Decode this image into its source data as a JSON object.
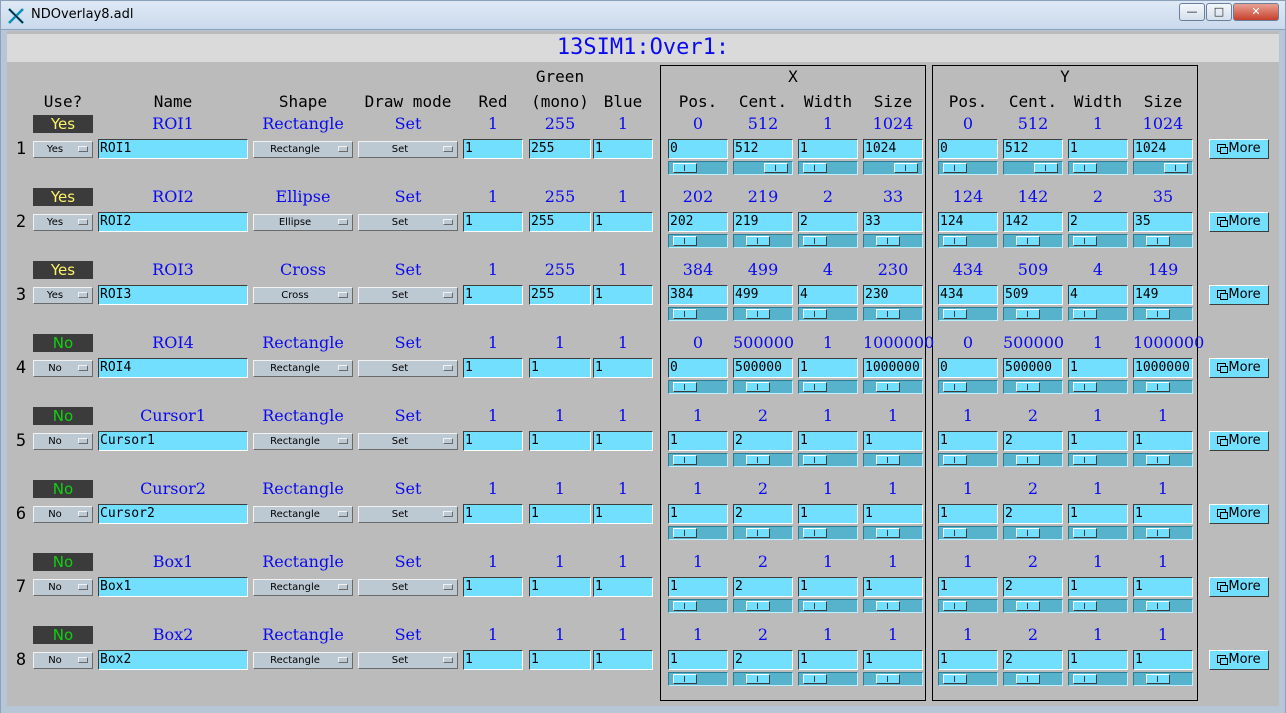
{
  "window": {
    "title": "NDOverlay8.adl",
    "min": "—",
    "max": "□",
    "close": "✕"
  },
  "screen_title": "13SIM1:Over1:",
  "headers": {
    "use": "Use?",
    "name": "Name",
    "shape": "Shape",
    "draw_mode": "Draw mode",
    "red": "Red",
    "green_top": "Green",
    "green_bottom": "(mono)",
    "blue": "Blue",
    "x_group": "X",
    "y_group": "Y",
    "pos": "Pos.",
    "cent": "Cent.",
    "width": "Width",
    "size": "Size"
  },
  "more_label": "More",
  "rows": [
    {
      "num": "1",
      "use": "Yes",
      "use_sel": "Yes",
      "name": "ROI1",
      "shape": "Rectangle",
      "mode": "Set",
      "red": "1",
      "green": "255",
      "blue": "1",
      "x": {
        "pos": "0",
        "cent": "512",
        "width": "1",
        "size": "1024"
      },
      "y": {
        "pos": "0",
        "cent": "512",
        "width": "1",
        "size": "1024"
      }
    },
    {
      "num": "2",
      "use": "Yes",
      "use_sel": "Yes",
      "name": "ROI2",
      "shape": "Ellipse",
      "mode": "Set",
      "red": "1",
      "green": "255",
      "blue": "1",
      "x": {
        "pos": "202",
        "cent": "219",
        "width": "2",
        "size": "33"
      },
      "y": {
        "pos": "124",
        "cent": "142",
        "width": "2",
        "size": "35"
      }
    },
    {
      "num": "3",
      "use": "Yes",
      "use_sel": "Yes",
      "name": "ROI3",
      "shape": "Cross",
      "mode": "Set",
      "red": "1",
      "green": "255",
      "blue": "1",
      "x": {
        "pos": "384",
        "cent": "499",
        "width": "4",
        "size": "230"
      },
      "y": {
        "pos": "434",
        "cent": "509",
        "width": "4",
        "size": "149"
      }
    },
    {
      "num": "4",
      "use": "No",
      "use_sel": "No",
      "name": "ROI4",
      "shape": "Rectangle",
      "mode": "Set",
      "red": "1",
      "green": "1",
      "blue": "1",
      "x": {
        "pos": "0",
        "cent": "500000",
        "width": "1",
        "size": "1000000"
      },
      "y": {
        "pos": "0",
        "cent": "500000",
        "width": "1",
        "size": "1000000"
      }
    },
    {
      "num": "5",
      "use": "No",
      "use_sel": "No",
      "name": "Cursor1",
      "shape": "Rectangle",
      "mode": "Set",
      "red": "1",
      "green": "1",
      "blue": "1",
      "x": {
        "pos": "1",
        "cent": "2",
        "width": "1",
        "size": "1"
      },
      "y": {
        "pos": "1",
        "cent": "2",
        "width": "1",
        "size": "1"
      }
    },
    {
      "num": "6",
      "use": "No",
      "use_sel": "No",
      "name": "Cursor2",
      "shape": "Rectangle",
      "mode": "Set",
      "red": "1",
      "green": "1",
      "blue": "1",
      "x": {
        "pos": "1",
        "cent": "2",
        "width": "1",
        "size": "1"
      },
      "y": {
        "pos": "1",
        "cent": "2",
        "width": "1",
        "size": "1"
      }
    },
    {
      "num": "7",
      "use": "No",
      "use_sel": "No",
      "name": "Box1",
      "shape": "Rectangle",
      "mode": "Set",
      "red": "1",
      "green": "1",
      "blue": "1",
      "x": {
        "pos": "1",
        "cent": "2",
        "width": "1",
        "size": "1"
      },
      "y": {
        "pos": "1",
        "cent": "2",
        "width": "1",
        "size": "1"
      }
    },
    {
      "num": "8",
      "use": "No",
      "use_sel": "No",
      "name": "Box2",
      "shape": "Rectangle",
      "mode": "Set",
      "red": "1",
      "green": "1",
      "blue": "1",
      "x": {
        "pos": "1",
        "cent": "2",
        "width": "1",
        "size": "1"
      },
      "y": {
        "pos": "1",
        "cent": "2",
        "width": "1",
        "size": "1"
      }
    }
  ],
  "colors": {
    "background": "#bbbbbb",
    "monitor_text": "#0a0af0",
    "entry_bg": "#73dfff",
    "indicator_bg": "#3b3b3b",
    "indicator_yes": "#fbf36a",
    "indicator_no": "#10d010"
  },
  "icons": {
    "window": "x-logo-icon",
    "more": "related-display-icon"
  }
}
